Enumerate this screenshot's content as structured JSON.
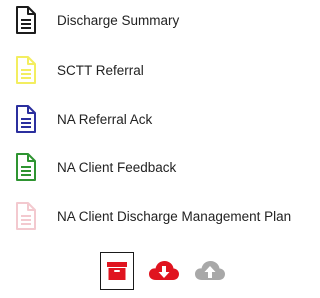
{
  "documents": [
    {
      "label": "Discharge Summary",
      "icon": "file-text-icon",
      "color": "#1c1c1c"
    },
    {
      "label": "SCTT Referral",
      "icon": "file-text-icon",
      "color": "#f3ee60"
    },
    {
      "label": "NA Referral Ack",
      "icon": "file-text-icon",
      "color": "#2b2f9e"
    },
    {
      "label": "NA Client Feedback",
      "icon": "file-text-icon",
      "color": "#2e9431"
    },
    {
      "label": "NA Client Discharge Management Plan",
      "icon": "file-text-icon",
      "color": "#f3c9cf"
    }
  ],
  "actions": {
    "archive": {
      "icon": "archive-box-icon",
      "color": "#e0141f"
    },
    "download": {
      "icon": "cloud-download-icon",
      "color": "#e0141f"
    },
    "upload": {
      "icon": "cloud-upload-icon",
      "color": "#a8a8a8"
    }
  }
}
